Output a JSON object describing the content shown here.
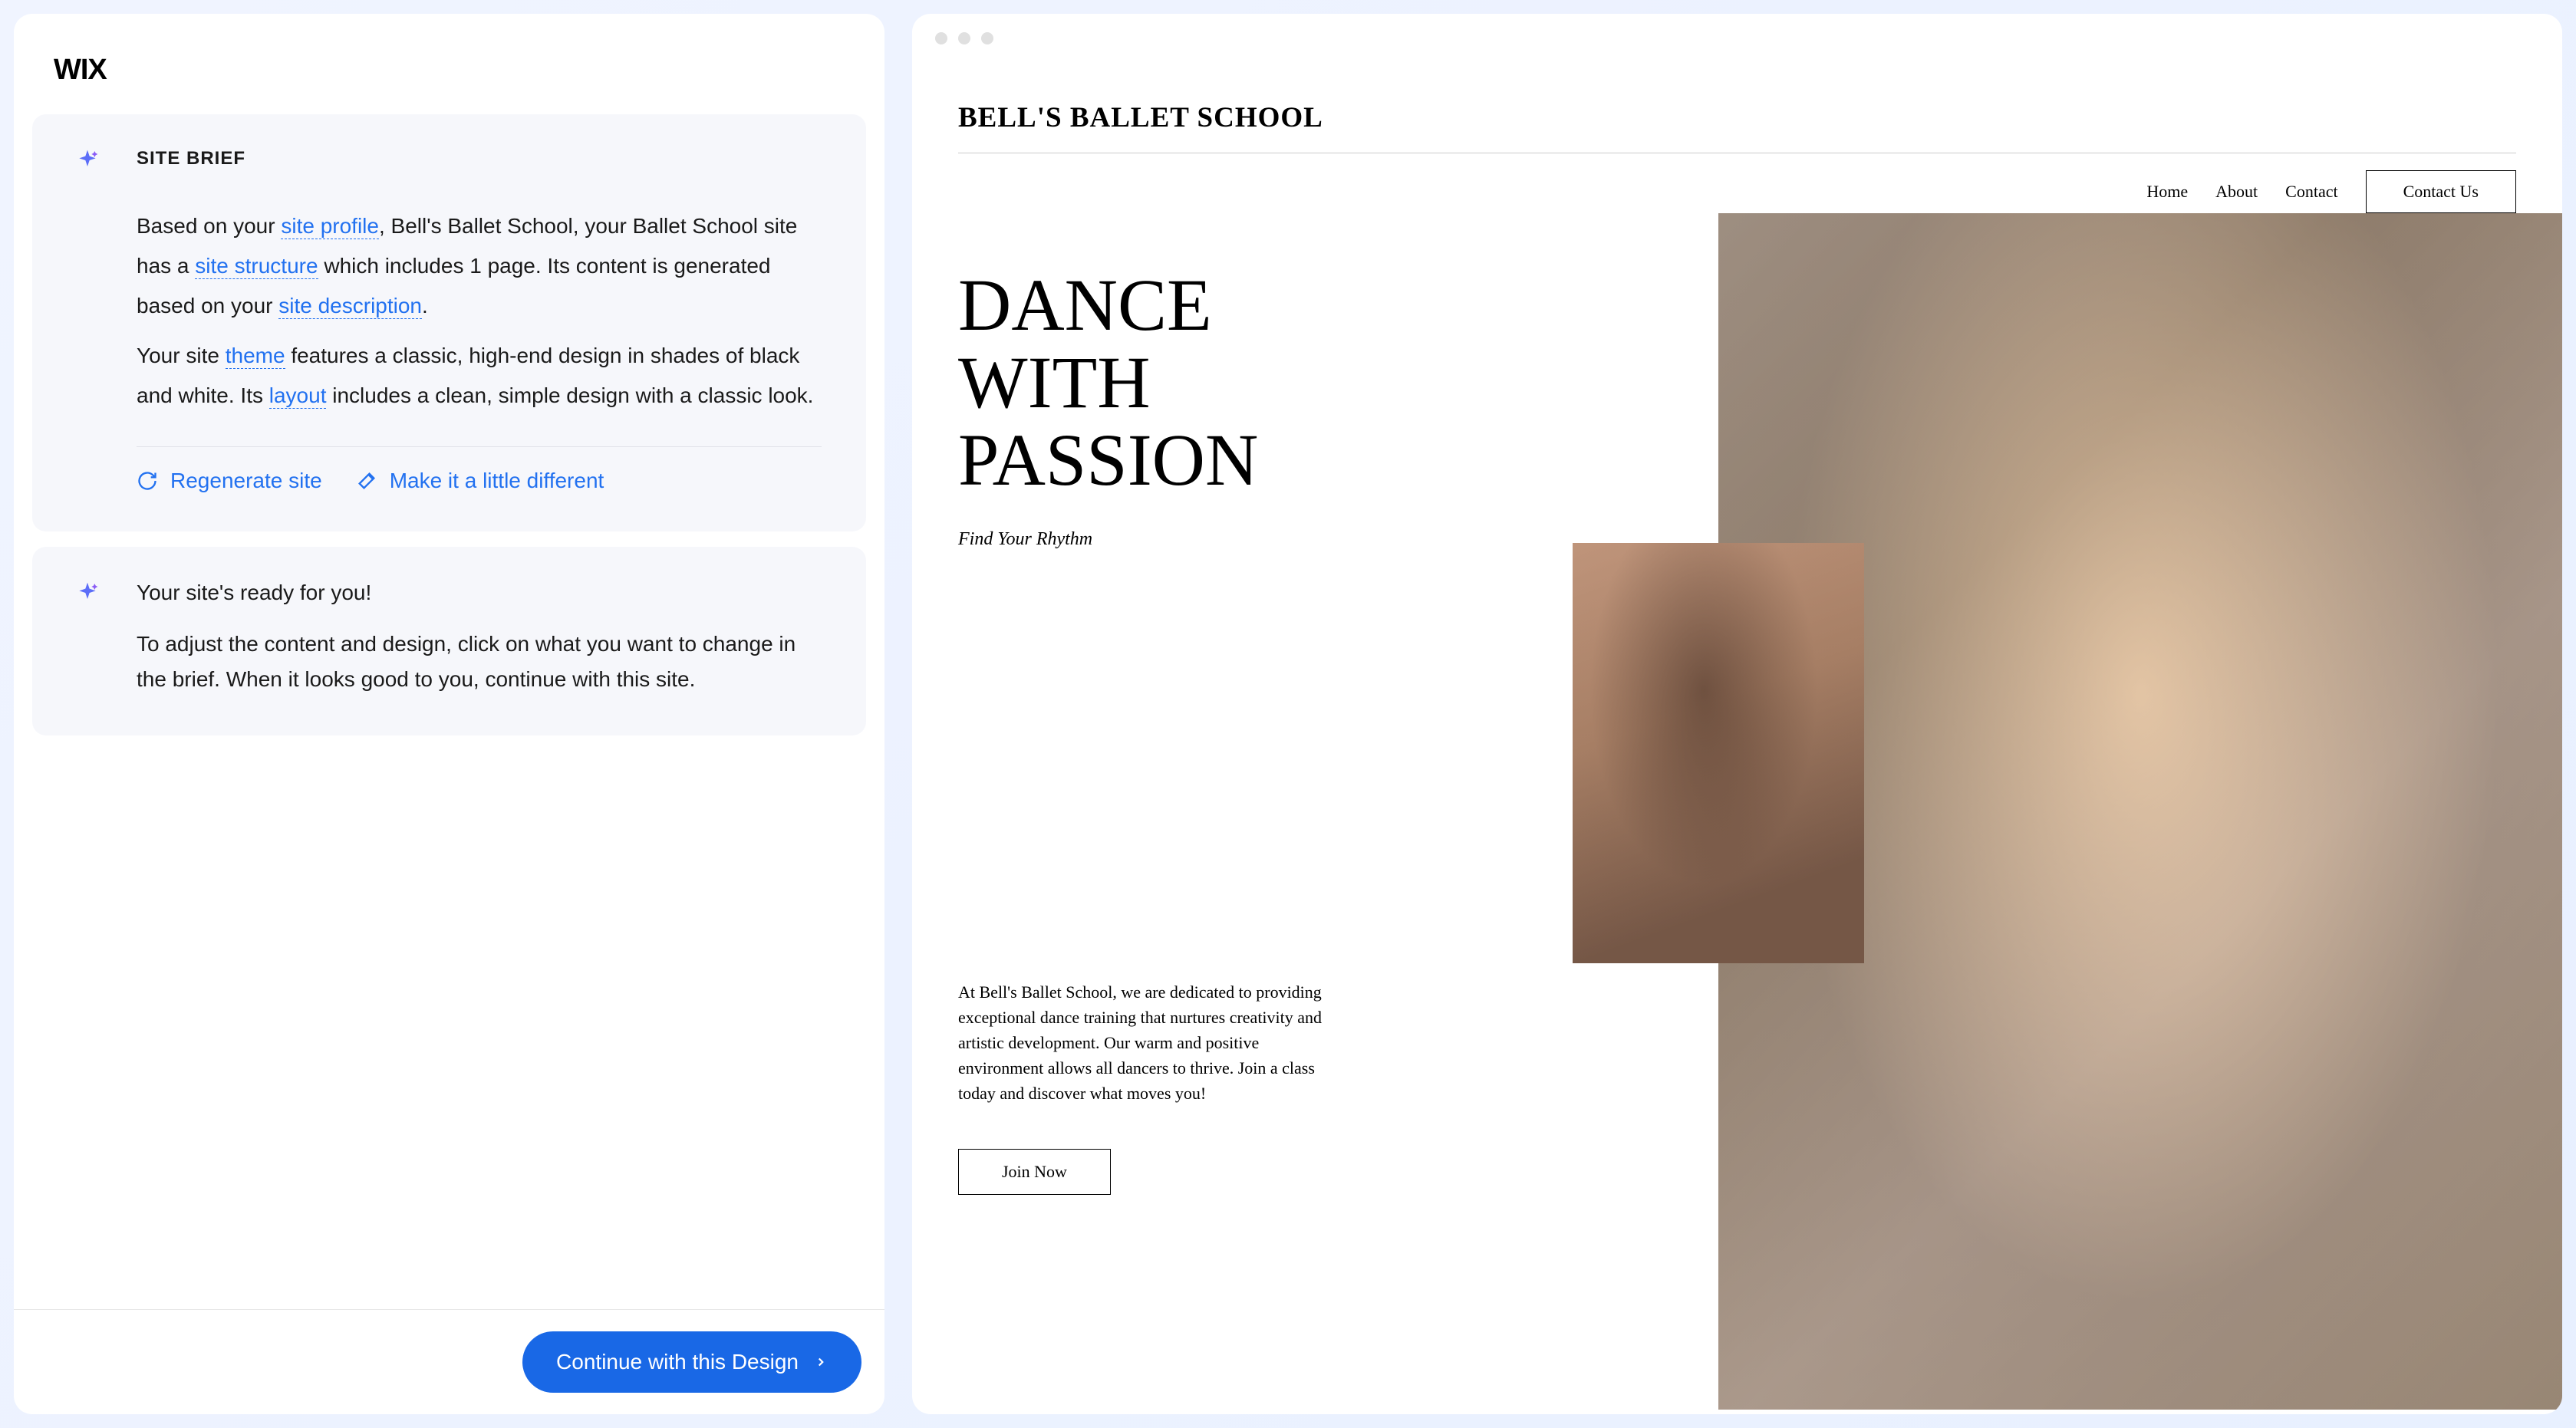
{
  "logo": "WIX",
  "brief": {
    "heading": "SITE BRIEF",
    "text_parts": {
      "p1a": "Based on your ",
      "link1": "site profile",
      "p1b": ", Bell's Ballet School, your Ballet School site has a ",
      "link2": "site structure",
      "p1c": " which includes 1 page. Its content is generated based on your ",
      "link3": "site description",
      "p1d": ".",
      "p2a": "Your site ",
      "link4": "theme",
      "p2b": " features a classic, high-end design in shades of black and white. Its ",
      "link5": "layout",
      "p2c": " includes a clean, simple design with a classic look."
    },
    "actions": {
      "regenerate": "Regenerate site",
      "make_different": "Make it a little different"
    }
  },
  "ready": {
    "heading": "Your site's ready for you!",
    "text": "To adjust the content and design, click on what you want to change in the brief. When it looks good to you, continue with this site."
  },
  "continue_label": "Continue with this Design",
  "preview": {
    "site_title": "BELL'S BALLET SCHOOL",
    "nav": {
      "home": "Home",
      "about": "About",
      "contact": "Contact",
      "contact_us": "Contact Us"
    },
    "hero": {
      "line1": "DANCE",
      "line2": "WITH",
      "line3": "PASSION",
      "tagline": "Find Your Rhythm"
    },
    "body_text": "At Bell's Ballet School, we are dedicated to providing exceptional dance training that nurtures creativity and artistic development. Our warm and positive environment allows all dancers to thrive. Join a class today and discover what moves you!",
    "join_label": "Join Now"
  }
}
